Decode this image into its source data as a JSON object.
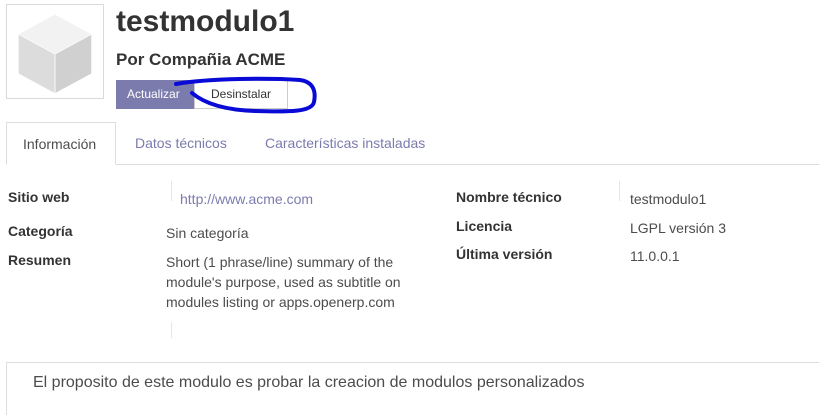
{
  "module": {
    "name": "testmodulo1",
    "author": "Por Compañia ACME"
  },
  "actions": {
    "update_label": "Actualizar",
    "uninstall_label": "Desinstalar"
  },
  "tabs": [
    {
      "label": "Información",
      "active": true
    },
    {
      "label": "Datos técnicos",
      "active": false
    },
    {
      "label": "Características instaladas",
      "active": false
    }
  ],
  "info": {
    "website_label": "Sitio web",
    "website_value": "http://www.acme.com",
    "category_label": "Categoría",
    "category_value": "Sin categoría",
    "summary_label": "Resumen",
    "summary_value": "Short (1 phrase/line) summary of the module's purpose, used as subtitle on modules listing or apps.openerp.com",
    "technical_name_label": "Nombre técnico",
    "technical_name_value": "testmodulo1",
    "license_label": "Licencia",
    "license_value": "LGPL versión 3",
    "latest_version_label": "Última versión",
    "latest_version_value": "11.0.0.1"
  },
  "description": "El proposito de este modulo es probar la creacion de modulos personalizados",
  "colors": {
    "primary": "#7c7bad",
    "annotation": "#0a0ad6"
  }
}
